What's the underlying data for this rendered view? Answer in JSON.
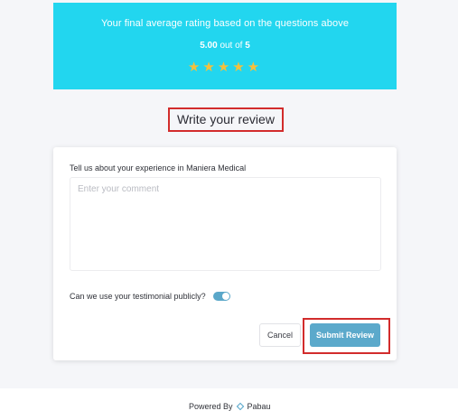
{
  "rating": {
    "caption": "Your final average rating based on the questions above",
    "score": "5.00",
    "out_of_text": "out of",
    "max": "5",
    "stars_filled": 5,
    "stars_total": 5
  },
  "heading": "Write your review",
  "form": {
    "prompt_label": "Tell us about your experience in Maniera Medical",
    "comment_placeholder": "Enter your comment",
    "comment_value": "",
    "testimonial_label": "Can we use your testimonial publicly?",
    "testimonial_enabled": true,
    "cancel_label": "Cancel",
    "submit_label": "Submit Review"
  },
  "footer": {
    "powered_by": "Powered By",
    "brand": "Pabau",
    "logo_icon": "pabau-logo-icon"
  },
  "colors": {
    "banner": "#22d6ef",
    "star": "#f5c03c",
    "accent": "#5ba9cb",
    "highlight": "#d22c2c"
  }
}
